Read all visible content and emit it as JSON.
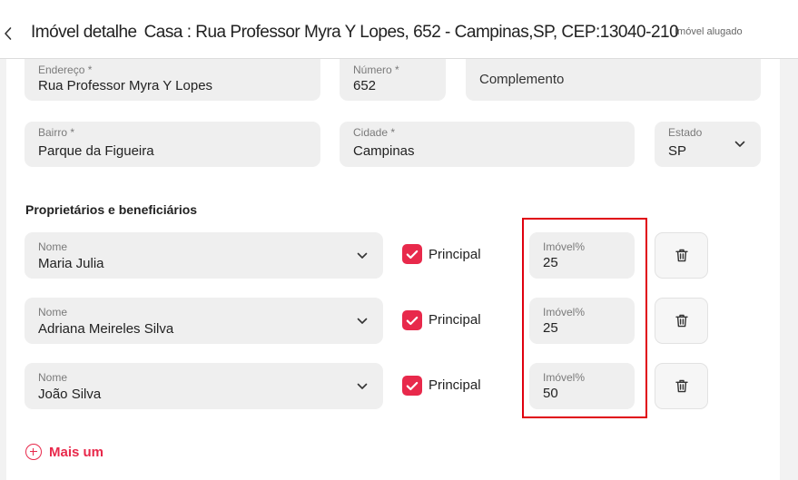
{
  "header": {
    "title_prefix": "Imóvel detalhe",
    "title_address": "Casa : Rua Professor Myra Y Lopes, 652 - Campinas,SP, CEP:13040-210",
    "status": "Imóvel alugado"
  },
  "address": {
    "endereco": {
      "label": "Endereço *",
      "value": "Rua Professor Myra Y Lopes"
    },
    "numero": {
      "label": "Número *",
      "value": "652"
    },
    "complemento": {
      "placeholder": "Complemento"
    },
    "bairro": {
      "label": "Bairro *",
      "value": "Parque da Figueira"
    },
    "cidade": {
      "label": "Cidade *",
      "value": "Campinas"
    },
    "estado": {
      "label": "Estado",
      "value": "SP"
    }
  },
  "owners": {
    "section_title": "Proprietários e beneficiários",
    "rows": [
      {
        "name_label": "Nome",
        "name": "Maria Julia",
        "principal_label": "Principal",
        "principal_checked": true,
        "pct_label": "Imóvel%",
        "pct": "25"
      },
      {
        "name_label": "Nome",
        "name": "Adriana Meireles Silva",
        "principal_label": "Principal",
        "principal_checked": true,
        "pct_label": "Imóvel%",
        "pct": "25"
      },
      {
        "name_label": "Nome",
        "name": "João Silva",
        "principal_label": "Principal",
        "principal_checked": true,
        "pct_label": "Imóvel%",
        "pct": "50"
      }
    ],
    "add_more_label": "Mais um"
  },
  "colors": {
    "accent": "#e8294b",
    "highlight": "#e0000f",
    "field_bg": "#efefef"
  }
}
